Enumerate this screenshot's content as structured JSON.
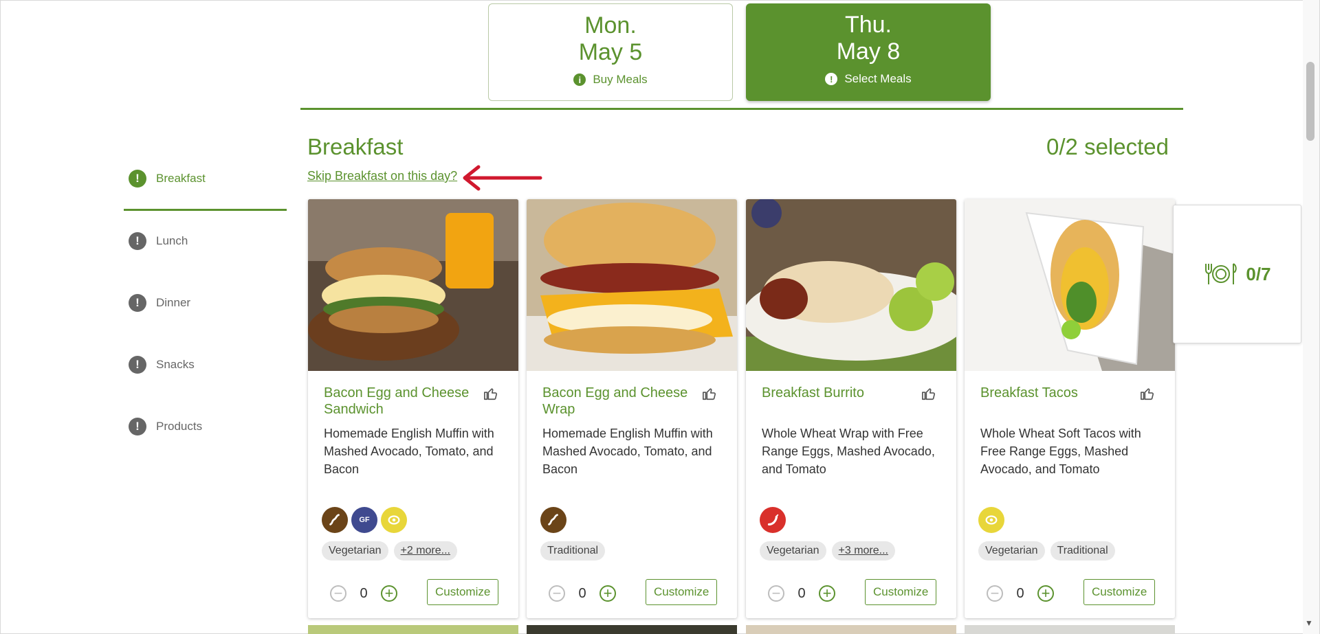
{
  "days": [
    {
      "name": "Mon.",
      "date": "May 5",
      "status": "Buy Meals"
    },
    {
      "name": "Thu.",
      "date": "May 8",
      "status": "Select Meals"
    }
  ],
  "sidebar": {
    "items": [
      {
        "label": "Breakfast"
      },
      {
        "label": "Lunch"
      },
      {
        "label": "Dinner"
      },
      {
        "label": "Snacks"
      },
      {
        "label": "Products"
      }
    ]
  },
  "section": {
    "title": "Breakfast",
    "selected": "0/2 selected",
    "skip_link": "Skip Breakfast on this day?"
  },
  "cards": [
    {
      "title": "Bacon Egg and Cheese Sandwich",
      "description": "Homemade English Muffin with Mashed Avocado, Tomato, and Bacon",
      "badges": [
        "bacon-icon",
        "GF",
        "egg-icon"
      ],
      "tags": [
        "Vegetarian",
        "+2 more..."
      ],
      "quantity": "0",
      "customize": "Customize"
    },
    {
      "title": "Bacon Egg and Cheese Wrap",
      "description": "Homemade English Muffin with Mashed Avocado, Tomato, and Bacon",
      "badges": [
        "bacon-icon"
      ],
      "tags": [
        "Traditional"
      ],
      "quantity": "0",
      "customize": "Customize"
    },
    {
      "title": "Breakfast Burrito",
      "description": "Whole Wheat Wrap with Free Range Eggs, Mashed Avocado, and Tomato",
      "badges": [
        "chili-icon"
      ],
      "tags": [
        "Vegetarian",
        "+3 more..."
      ],
      "quantity": "0",
      "customize": "Customize"
    },
    {
      "title": "Breakfast Tacos",
      "description": "Whole Wheat Soft Tacos with Free Range Eggs, Mashed Avocado, and Tomato",
      "badges": [
        "egg-icon"
      ],
      "tags": [
        "Vegetarian",
        "Traditional"
      ],
      "quantity": "0",
      "customize": "Customize"
    }
  ],
  "meal_counter": "0/7",
  "colors": {
    "accent": "#5b922e",
    "muted": "#666666",
    "bacon": "#6b4418",
    "gf": "#3f4a8f",
    "egg": "#e8d63a",
    "chili": "#d9302b",
    "arrow": "#d0182e"
  }
}
